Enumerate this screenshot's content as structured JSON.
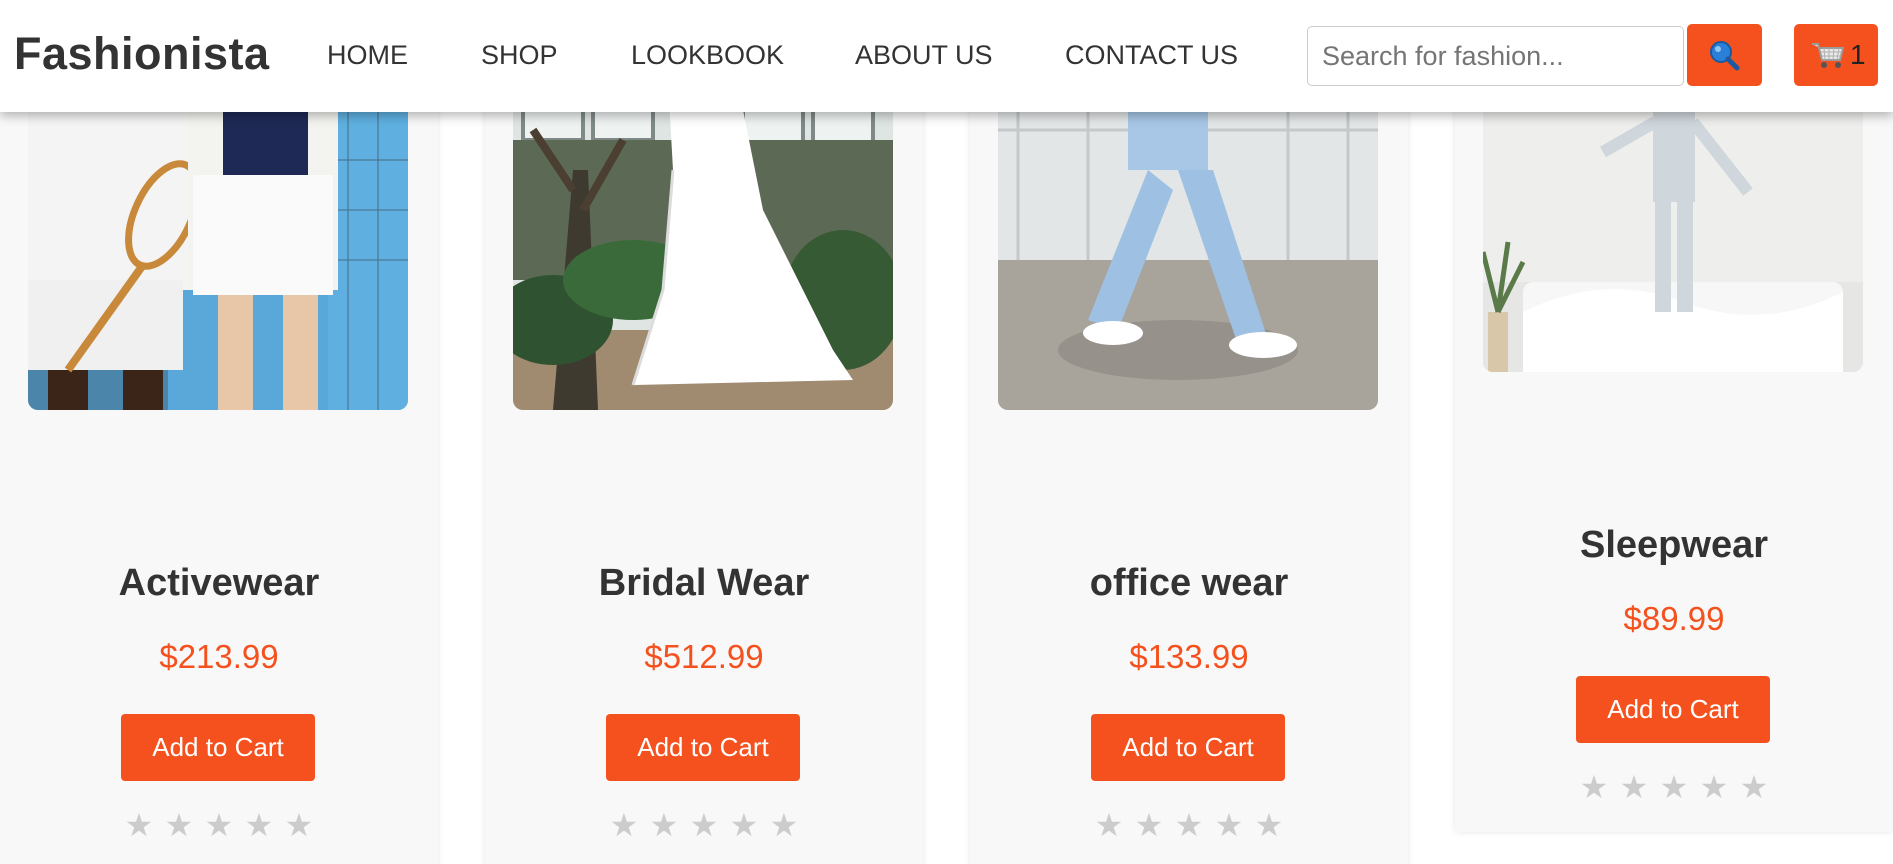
{
  "header": {
    "logo": "Fashionista",
    "nav": [
      "HOME",
      "SHOP",
      "LOOKBOOK",
      "ABOUT US",
      "CONTACT US"
    ],
    "search": {
      "placeholder": "Search for fashion...",
      "value": ""
    },
    "search_icon": "magnifier-icon",
    "cart_icon": "shopping-cart-icon",
    "cart_count": "1"
  },
  "colors": {
    "accent": "#f4511e",
    "text": "#333333",
    "star_empty": "#cccccc",
    "card_bg": "#f8f8f8"
  },
  "products": [
    {
      "title": "Activewear",
      "price": "$213.99",
      "button": "Add to Cart",
      "rating": 0,
      "image": "tennis-couple-photo"
    },
    {
      "title": "Bridal Wear",
      "price": "$512.99",
      "button": "Add to Cart",
      "rating": 0,
      "image": "wedding-dress-photo"
    },
    {
      "title": "office wear",
      "price": "$133.99",
      "button": "Add to Cart",
      "rating": 0,
      "image": "blue-suit-walking-photo"
    },
    {
      "title": "Sleepwear",
      "price": "$89.99",
      "button": "Add to Cart",
      "rating": 0,
      "image": "pajamas-jumping-on-bed-photo"
    }
  ],
  "star_glyph": "★"
}
